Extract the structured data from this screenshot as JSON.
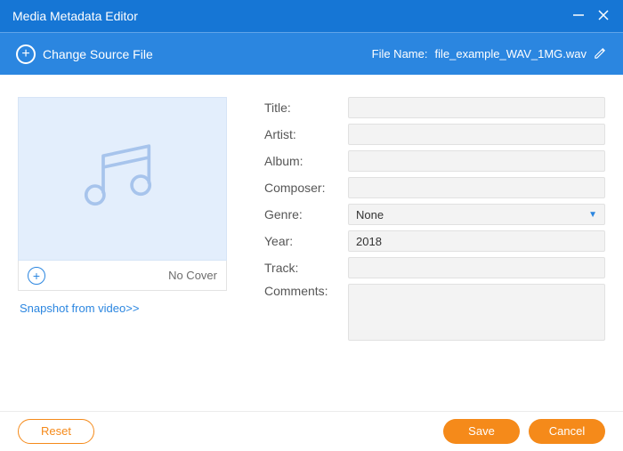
{
  "titlebar": {
    "title": "Media Metadata Editor"
  },
  "toolbar": {
    "change_source_label": "Change Source File",
    "filename_label": "File Name:",
    "filename_value": "file_example_WAV_1MG.wav"
  },
  "cover": {
    "no_cover_text": "No Cover",
    "snapshot_link": "Snapshot from video>>"
  },
  "form": {
    "labels": {
      "title": "Title:",
      "artist": "Artist:",
      "album": "Album:",
      "composer": "Composer:",
      "genre": "Genre:",
      "year": "Year:",
      "track": "Track:",
      "comments": "Comments:"
    },
    "values": {
      "title": "",
      "artist": "",
      "album": "",
      "composer": "",
      "genre_selected": "None",
      "year": "2018",
      "track": "",
      "comments": ""
    }
  },
  "footer": {
    "reset": "Reset",
    "save": "Save",
    "cancel": "Cancel"
  }
}
